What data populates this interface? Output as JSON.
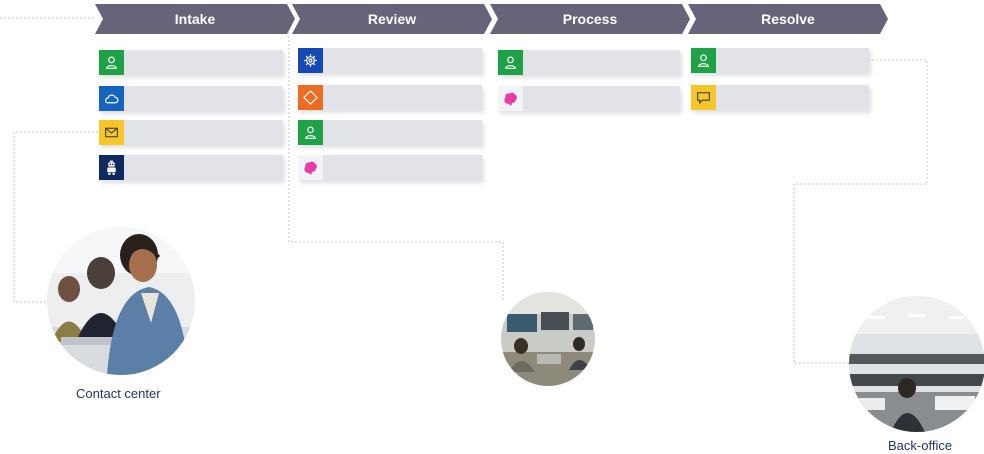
{
  "stages": [
    {
      "label": "Intake"
    },
    {
      "label": "Review"
    },
    {
      "label": "Process"
    },
    {
      "label": "Resolve"
    }
  ],
  "steps": {
    "intake": [
      "person-icon",
      "cloud-icon",
      "envelope-icon",
      "robot-icon"
    ],
    "review": [
      "gear-icon",
      "diamond-icon",
      "person-icon",
      "brain-icon"
    ],
    "process": [
      "person-icon",
      "brain-icon"
    ],
    "resolve": [
      "person-icon",
      "chat-bubble-icon"
    ]
  },
  "icon_colors": {
    "person": "#1fa245",
    "cloud": "#1565c0",
    "envelope": "#f5c52a",
    "robot": "#0f2960",
    "gear": "#1549b8",
    "diamond": "#ef6a23",
    "brain": "#e83da4",
    "chat": "#f5c52a"
  },
  "locations": [
    {
      "caption": "Contact center"
    },
    {
      "caption": ""
    },
    {
      "caption": "Back-office"
    }
  ],
  "colors": {
    "stage_bar": "#656478",
    "step_bar": "#e2e3e8",
    "connector": "#c4c4c4",
    "caption": "#25346b"
  }
}
